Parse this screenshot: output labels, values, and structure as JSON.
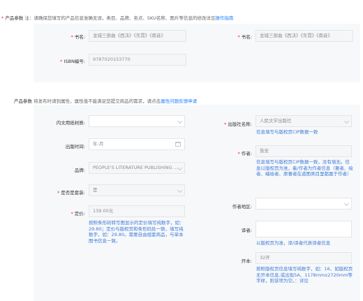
{
  "top": {
    "required_mark": "*",
    "label": "产品参数",
    "note": "注：请确保您填写的产品信息准确无误，类目、品牌、卖点、SKU名称、图片等信息的修改详见",
    "link": "操作指南"
  },
  "group1": {
    "book_title_label": "书名:",
    "book_title_value": "龙城三部曲《西决》《东霓》《南音》",
    "book_title_label_2": "书名:",
    "book_title_value_2": "龙城三部曲《西决》《东霓》《南音》",
    "isbn_label": "ISBN编号:",
    "isbn_value": "9787020153770"
  },
  "section2": {
    "label": "产品参数",
    "note": "将发布时请到属性，属性值不能满足您提交商品的需求，请点击",
    "link": "属性问题反馈申请"
  },
  "left_fields": {
    "paper_label": "内文用纸材质:",
    "paper_value": "",
    "date_label": "出版时间:",
    "date_placeholder": "年-月",
    "brand_label": "品牌:",
    "brand_value": "PEOPLE'S LITERATURE PUBLISHING ...",
    "set_label": "是否是套装:",
    "set_value": "是",
    "price_label": "定价:",
    "price_value": "139.00元",
    "price_help": "按照条形码转写图显示的定价填写纯数字，如：29.80；定价与版权页和条形码处一致，填写纯数字，如：29.80。需要自由组套商品，与单本图书信息一致。"
  },
  "right_fields": {
    "publisher_label": "出版社名称:",
    "publisher_value": "人民文学出版社",
    "publisher_help": "信息填写与版权页CIP数据一致",
    "author_label": "作者:",
    "author_value": "笛安",
    "author_help": "信息填写与版权页CIP数据一致，没有填无。信息以版权页为准，着/作者为作者信息（著者、绘者、编绘者、原著者在道图类目里都属于作者）",
    "region_label": "作者地区:",
    "region_value": "",
    "translator_label": "译者:",
    "translator_value": "",
    "translator_help": "以版权页为准，译/译者代表译者信息",
    "format_label": "开本:",
    "format_value": "32开",
    "format_help": "按照版权页信息填写纯数字，如：16、如版权页无开本信息,或出现5A、1178mmx2720mm等字样，则该项为空。：详见"
  }
}
